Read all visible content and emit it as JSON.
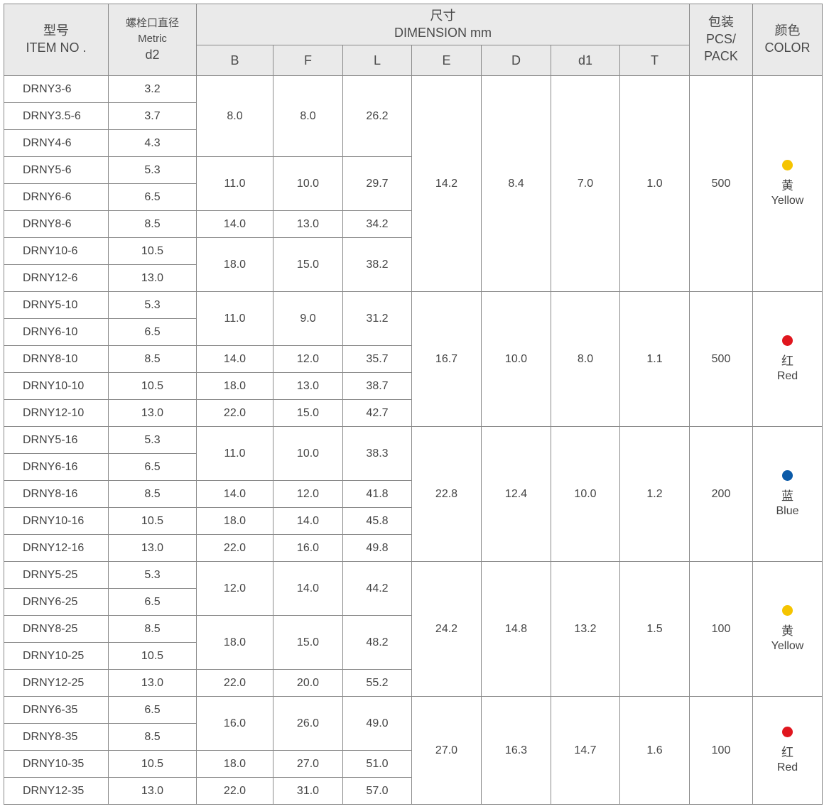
{
  "header": {
    "item_cn": "型号",
    "item_en": "ITEM NO .",
    "d2_cn": "螺栓口直径",
    "d2_en": "Metric",
    "d2_sym": "d2",
    "dim_cn": "尺寸",
    "dim_en": "DIMENSION mm",
    "cols": [
      "B",
      "F",
      "L",
      "E",
      "D",
      "d1",
      "T"
    ],
    "pack_cn": "包装",
    "pack_en1": "PCS/",
    "pack_en2": "PACK",
    "color_cn": "颜色",
    "color_en": "COLOR"
  },
  "groups": [
    {
      "E": "14.2",
      "D": "8.4",
      "d1": "7.0",
      "T": "1.0",
      "pack": "500",
      "color_cn": "黄",
      "color_en": "Yellow",
      "color_hex": "#f5c400",
      "rows": [
        {
          "item": "DRNY3-6",
          "d2": "3.2"
        },
        {
          "item": "DRNY3.5-6",
          "d2": "3.7"
        },
        {
          "item": "DRNY4-6",
          "d2": "4.3"
        },
        {
          "item": "DRNY5-6",
          "d2": "5.3"
        },
        {
          "item": "DRNY6-6",
          "d2": "6.5"
        },
        {
          "item": "DRNY8-6",
          "d2": "8.5"
        },
        {
          "item": "DRNY10-6",
          "d2": "10.5"
        },
        {
          "item": "DRNY12-6",
          "d2": "13.0"
        }
      ],
      "bfl": [
        {
          "B": "8.0",
          "F": "8.0",
          "L": "26.2",
          "span": 3
        },
        {
          "B": "11.0",
          "F": "10.0",
          "L": "29.7",
          "span": 2
        },
        {
          "B": "14.0",
          "F": "13.0",
          "L": "34.2",
          "span": 1
        },
        {
          "B": "18.0",
          "F": "15.0",
          "L": "38.2",
          "span": 2
        }
      ]
    },
    {
      "E": "16.7",
      "D": "10.0",
      "d1": "8.0",
      "T": "1.1",
      "pack": "500",
      "color_cn": "红",
      "color_en": "Red",
      "color_hex": "#e0161e",
      "rows": [
        {
          "item": "DRNY5-10",
          "d2": "5.3"
        },
        {
          "item": "DRNY6-10",
          "d2": "6.5"
        },
        {
          "item": "DRNY8-10",
          "d2": "8.5"
        },
        {
          "item": "DRNY10-10",
          "d2": "10.5"
        },
        {
          "item": "DRNY12-10",
          "d2": "13.0"
        }
      ],
      "bfl": [
        {
          "B": "11.0",
          "F": "9.0",
          "L": "31.2",
          "span": 2
        },
        {
          "B": "14.0",
          "F": "12.0",
          "L": "35.7",
          "span": 1
        },
        {
          "B": "18.0",
          "F": "13.0",
          "L": "38.7",
          "span": 1
        },
        {
          "B": "22.0",
          "F": "15.0",
          "L": "42.7",
          "span": 1
        }
      ]
    },
    {
      "E": "22.8",
      "D": "12.4",
      "d1": "10.0",
      "T": "1.2",
      "pack": "200",
      "color_cn": "蓝",
      "color_en": "Blue",
      "color_hex": "#0b5aa8",
      "rows": [
        {
          "item": "DRNY5-16",
          "d2": "5.3"
        },
        {
          "item": "DRNY6-16",
          "d2": "6.5"
        },
        {
          "item": "DRNY8-16",
          "d2": "8.5"
        },
        {
          "item": "DRNY10-16",
          "d2": "10.5"
        },
        {
          "item": "DRNY12-16",
          "d2": "13.0"
        }
      ],
      "bfl": [
        {
          "B": "11.0",
          "F": "10.0",
          "L": "38.3",
          "span": 2
        },
        {
          "B": "14.0",
          "F": "12.0",
          "L": "41.8",
          "span": 1
        },
        {
          "B": "18.0",
          "F": "14.0",
          "L": "45.8",
          "span": 1
        },
        {
          "B": "22.0",
          "F": "16.0",
          "L": "49.8",
          "span": 1
        }
      ]
    },
    {
      "E": "24.2",
      "D": "14.8",
      "d1": "13.2",
      "T": "1.5",
      "pack": "100",
      "color_cn": "黄",
      "color_en": "Yellow",
      "color_hex": "#f5c400",
      "rows": [
        {
          "item": "DRNY5-25",
          "d2": "5.3"
        },
        {
          "item": "DRNY6-25",
          "d2": "6.5"
        },
        {
          "item": "DRNY8-25",
          "d2": "8.5"
        },
        {
          "item": "DRNY10-25",
          "d2": "10.5"
        },
        {
          "item": "DRNY12-25",
          "d2": "13.0"
        }
      ],
      "bfl": [
        {
          "B": "12.0",
          "F": "14.0",
          "L": "44.2",
          "span": 2
        },
        {
          "B": "18.0",
          "F": "15.0",
          "L": "48.2",
          "span": 2
        },
        {
          "B": "22.0",
          "F": "20.0",
          "L": "55.2",
          "span": 1
        }
      ]
    },
    {
      "E": "27.0",
      "D": "16.3",
      "d1": "14.7",
      "T": "1.6",
      "pack": "100",
      "color_cn": "红",
      "color_en": "Red",
      "color_hex": "#e0161e",
      "rows": [
        {
          "item": "DRNY6-35",
          "d2": "6.5"
        },
        {
          "item": "DRNY8-35",
          "d2": "8.5"
        },
        {
          "item": "DRNY10-35",
          "d2": "10.5"
        },
        {
          "item": "DRNY12-35",
          "d2": "13.0"
        }
      ],
      "bfl": [
        {
          "B": "16.0",
          "F": "26.0",
          "L": "49.0",
          "span": 2
        },
        {
          "B": "18.0",
          "F": "27.0",
          "L": "51.0",
          "span": 1
        },
        {
          "B": "22.0",
          "F": "31.0",
          "L": "57.0",
          "span": 1
        }
      ]
    }
  ]
}
